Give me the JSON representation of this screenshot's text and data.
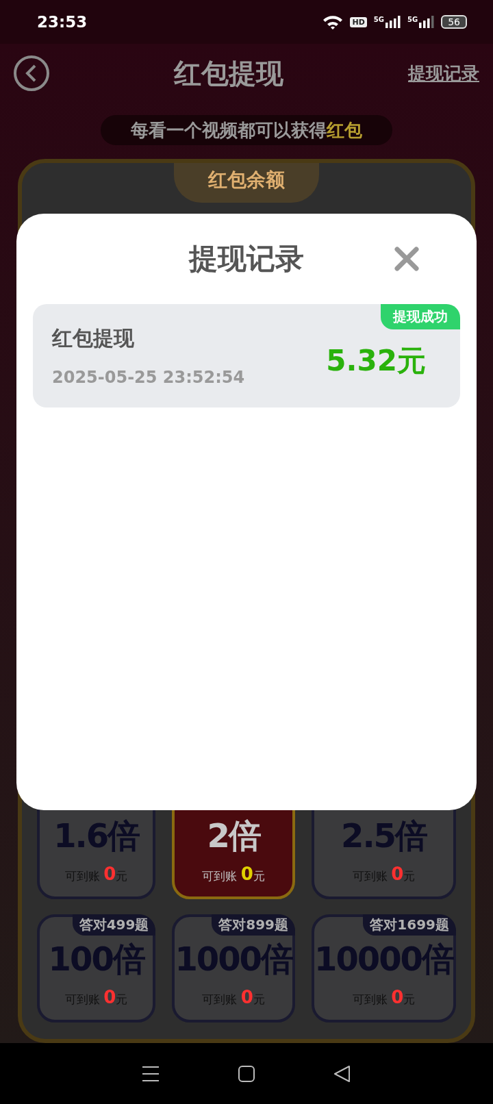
{
  "status_bar": {
    "time": "23:53",
    "hd": "HD",
    "networks": [
      "5G",
      "5G"
    ],
    "battery": "56"
  },
  "header": {
    "title": "红包提现",
    "link": "提现记录"
  },
  "banner": {
    "text": "每看一个视频都可以获得",
    "highlight": "红包"
  },
  "balance_card": {
    "title": "红包余额"
  },
  "multipliers": [
    {
      "value": "1.6倍",
      "note": "可到账",
      "amount": "0",
      "unit": "元",
      "selected": false
    },
    {
      "value": "2倍",
      "note": "可到账",
      "amount": "0",
      "unit": "元",
      "selected": true
    },
    {
      "value": "2.5倍",
      "note": "可到账",
      "amount": "0",
      "unit": "元",
      "selected": false
    },
    {
      "badge": "答对499题",
      "value": "100倍",
      "note": "可到账",
      "amount": "0",
      "unit": "元",
      "selected": false
    },
    {
      "badge": "答对899题",
      "value": "1000倍",
      "note": "可到账",
      "amount": "0",
      "unit": "元",
      "selected": false
    },
    {
      "badge": "答对1699题",
      "value": "10000倍",
      "note": "可到账",
      "amount": "0",
      "unit": "元",
      "selected": false
    }
  ],
  "dialog": {
    "title": "提现记录",
    "records": [
      {
        "title": "红包提现",
        "time": "2025-05-25 23:52:54",
        "amount": "5.32元",
        "status": "提现成功"
      }
    ]
  }
}
